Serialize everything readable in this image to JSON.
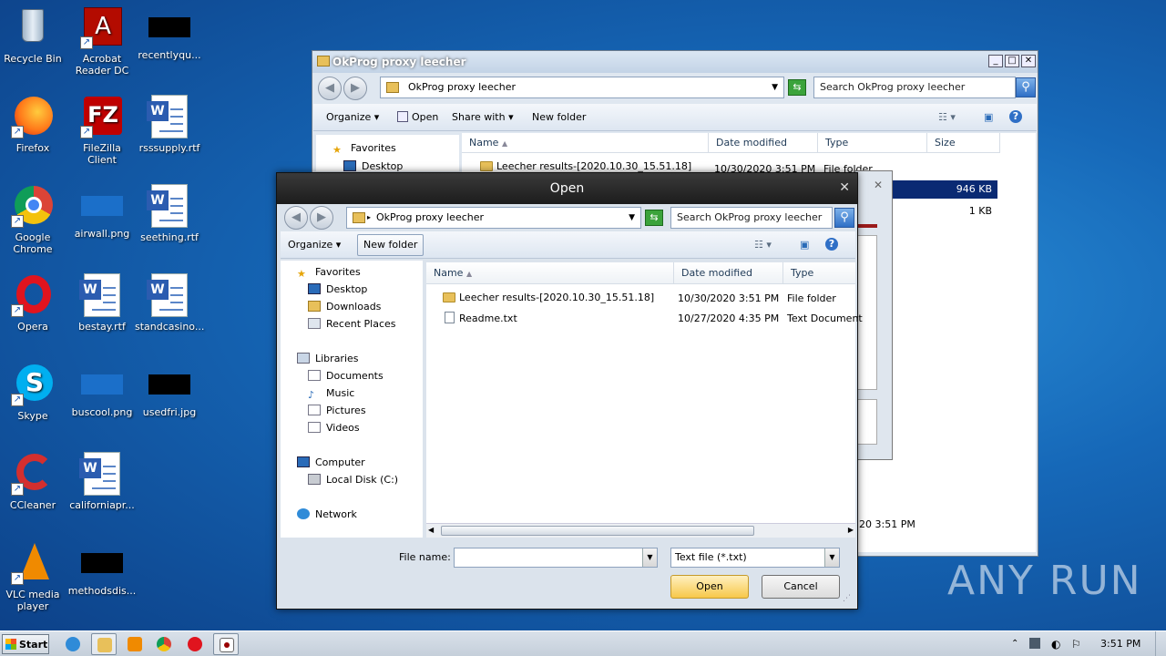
{
  "desktop": {
    "icons": [
      {
        "label": "Recycle Bin"
      },
      {
        "label": "Acrobat Reader DC"
      },
      {
        "label": "recentlyqu..."
      },
      {
        "label": "Firefox"
      },
      {
        "label": "FileZilla Client"
      },
      {
        "label": "rsssupply.rtf"
      },
      {
        "label": "Google Chrome"
      },
      {
        "label": "airwall.png"
      },
      {
        "label": "seething.rtf"
      },
      {
        "label": "Opera"
      },
      {
        "label": "bestay.rtf"
      },
      {
        "label": "standcasino..."
      },
      {
        "label": "Skype"
      },
      {
        "label": "buscool.png"
      },
      {
        "label": "usedfri.jpg"
      },
      {
        "label": "CCleaner"
      },
      {
        "label": "californiapr..."
      },
      {
        "label": "VLC media player"
      },
      {
        "label": "methodsdis..."
      }
    ],
    "watermark": "ANY RUN"
  },
  "explorer": {
    "title": "OkProg proxy leecher",
    "address": "OkProg proxy leecher",
    "search_placeholder": "Search OkProg proxy leecher",
    "toolbar": {
      "organize": "Organize",
      "open": "Open",
      "share_with": "Share with",
      "new_folder": "New folder"
    },
    "nav": {
      "favorites": "Favorites",
      "desktop": "Desktop"
    },
    "columns": [
      "Name",
      "Date modified",
      "Type",
      "Size"
    ],
    "rows": [
      {
        "name": "Leecher results-[2020.10.30_15.51.18]",
        "date": "10/30/2020 3:51 PM",
        "type": "File folder",
        "size": ""
      }
    ],
    "sizes": [
      "946 KB",
      "1 KB"
    ],
    "status_date": "20 3:51 PM"
  },
  "dialog": {
    "title": "Open",
    "address": "OkProg proxy leecher",
    "search_placeholder": "Search OkProg proxy leecher",
    "toolbar": {
      "organize": "Organize",
      "new_folder": "New folder"
    },
    "nav": {
      "favorites": "Favorites",
      "desktop": "Desktop",
      "downloads": "Downloads",
      "recent": "Recent Places",
      "libraries": "Libraries",
      "documents": "Documents",
      "music": "Music",
      "pictures": "Pictures",
      "videos": "Videos",
      "computer": "Computer",
      "local_disk": "Local Disk (C:)",
      "network": "Network"
    },
    "columns": [
      "Name",
      "Date modified",
      "Type"
    ],
    "rows": [
      {
        "name": "Leecher results-[2020.10.30_15.51.18]",
        "date": "10/30/2020 3:51 PM",
        "type": "File folder"
      },
      {
        "name": "Readme.txt",
        "date": "10/27/2020 4:35 PM",
        "type": "Text Document"
      }
    ],
    "file_name_label": "File name:",
    "file_name_value": "",
    "file_type": "Text file (*.txt)",
    "open_button": "Open",
    "cancel_button": "Cancel"
  },
  "taskbar": {
    "start": "Start",
    "clock": "3:51 PM"
  }
}
